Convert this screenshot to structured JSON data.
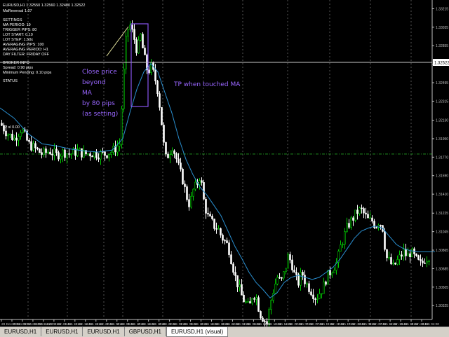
{
  "header": {
    "symbol_line": "EURUSD,H1  1.32550 1.32560 1.32480 1.32522",
    "ea_name": "MaReversal 1.07",
    "settings": [
      "SETTINGS",
      "MA PERIOD: 19",
      "TRIGGER PIPS: 80",
      "LOT START: 0.10",
      "LOT STEP: 1.50x",
      "AVERAGING PIPS: 100",
      "AVERAGING PERIOD: H1",
      "DAY FILTER: FRIDAY OFF"
    ],
    "broker": [
      "BROKER INFO",
      "Spread: 0.90 pips",
      "Minimum Pending: 0.10 pips"
    ],
    "status": "STATUS"
  },
  "annotations": {
    "close_price": [
      "Close price",
      "beyond",
      "MA",
      "by 80 pips",
      "(as setting)"
    ],
    "tp": "TP when touched MA"
  },
  "hline_label": "#2 sl 0.00",
  "tabs": [
    "EURUSD,H1",
    "EURUSD,H1",
    "EURUSD,H1",
    "GBPUSD,H1",
    "EURUSD,H1 (visual)"
  ],
  "active_tab": 4,
  "colors": {
    "background": "#000000",
    "bull": "#00c800",
    "bear": "#ffffff",
    "ma": "#2a8fd0",
    "hline": "#1f8f1f",
    "annotation": "#9966ff",
    "grid": "#8a8a8a",
    "axis_text": "#c0c0c0",
    "price_box": "#ffffff"
  },
  "chart_data": {
    "type": "candlestick",
    "symbol": "EURUSD",
    "timeframe": "H1",
    "ylim": [
      1.3019,
      1.333
    ],
    "y_ticks": [
      1.33215,
      1.33035,
      1.32855,
      1.32675,
      1.32495,
      1.32315,
      1.3213,
      1.3195,
      1.3177,
      1.3159,
      1.3141,
      1.31225,
      1.31045,
      1.30865,
      1.30685,
      1.30505,
      1.30325
    ],
    "current_price": 1.32522,
    "horizontal_line": 1.318,
    "x_tick_labels": [
      "28 Dec 2012",
      "31 Dec 2012",
      "31 Dec 16:00",
      "31 Dec 22:00",
      "1 Jan 02:00",
      "1 Jan 06:00",
      "1 Jan 10:00",
      "1 Jan 14:00",
      "1 Jan 18:00",
      "1 Jan 22:00",
      "2 Jan 02:00",
      "2 Jan 06:00",
      "2 Jan 10:00",
      "2 Jan 14:00",
      "2 Jan 18:00",
      "2 Jan 22:00",
      "3 Jan 02:00",
      "3 Jan 06:00",
      "3 Jan 10:00",
      "3 Jan 14:00",
      "3 Jan 18:00",
      "3 Jan 22:00",
      "4 Jan 02:00",
      "4 Jan 06:00",
      "4 Jan 10:00",
      "4 Jan 14:00",
      "4 Jan 18:00",
      "4 Jan 22:00",
      "7 Jan 03:00",
      "7 Jan 07:00",
      "7 Jan 11:00",
      "7 Jan 15:00",
      "7 Jan 19:00",
      "7 Jan 23:00",
      "8 Jan 03:00",
      "8 Jan 07:00",
      "8 Jan 11:00",
      "8 Jan 15:00",
      "8 Jan 19:00",
      "8 Jan 23:00",
      "9 Jan 04:00"
    ],
    "close_path": [
      [
        0,
        1.321
      ],
      [
        10,
        1.32
      ],
      [
        20,
        1.3195
      ],
      [
        30,
        1.3205
      ],
      [
        40,
        1.319
      ],
      [
        50,
        1.3185
      ],
      [
        60,
        1.318
      ],
      [
        70,
        1.3183
      ],
      [
        80,
        1.3179
      ],
      [
        90,
        1.3182
      ],
      [
        100,
        1.318
      ],
      [
        110,
        1.3183
      ],
      [
        120,
        1.318
      ],
      [
        130,
        1.3181
      ],
      [
        140,
        1.318
      ],
      [
        150,
        1.318
      ],
      [
        160,
        1.3183
      ],
      [
        170,
        1.319
      ],
      [
        176,
        1.326
      ],
      [
        180,
        1.33
      ],
      [
        185,
        1.3305
      ],
      [
        190,
        1.3295
      ],
      [
        195,
        1.328
      ],
      [
        200,
        1.3295
      ],
      [
        205,
        1.3275
      ],
      [
        210,
        1.326
      ],
      [
        215,
        1.3265
      ],
      [
        220,
        1.3255
      ],
      [
        225,
        1.324
      ],
      [
        230,
        1.321
      ],
      [
        235,
        1.3175
      ],
      [
        240,
        1.318
      ],
      [
        245,
        1.3188
      ],
      [
        250,
        1.3178
      ],
      [
        255,
        1.3165
      ],
      [
        260,
        1.3155
      ],
      [
        265,
        1.314
      ],
      [
        270,
        1.313
      ],
      [
        275,
        1.3145
      ],
      [
        280,
        1.315
      ],
      [
        285,
        1.316
      ],
      [
        290,
        1.3135
      ],
      [
        295,
        1.312
      ],
      [
        300,
        1.3115
      ],
      [
        305,
        1.311
      ],
      [
        310,
        1.3108
      ],
      [
        315,
        1.31
      ],
      [
        320,
        1.3095
      ],
      [
        325,
        1.309
      ],
      [
        330,
        1.3075
      ],
      [
        335,
        1.306
      ],
      [
        340,
        1.305
      ],
      [
        345,
        1.304
      ],
      [
        350,
        1.3035
      ],
      [
        355,
        1.303
      ],
      [
        360,
        1.3045
      ],
      [
        365,
        1.304
      ],
      [
        370,
        1.3025
      ],
      [
        375,
        1.302
      ],
      [
        380,
        1.3015
      ],
      [
        385,
        1.3035
      ],
      [
        390,
        1.305
      ],
      [
        395,
        1.306
      ],
      [
        400,
        1.3055
      ],
      [
        405,
        1.3065
      ],
      [
        410,
        1.308
      ],
      [
        415,
        1.3075
      ],
      [
        420,
        1.306
      ],
      [
        425,
        1.3055
      ],
      [
        430,
        1.3065
      ],
      [
        435,
        1.3055
      ],
      [
        440,
        1.305
      ],
      [
        445,
        1.3045
      ],
      [
        450,
        1.304
      ],
      [
        455,
        1.3045
      ],
      [
        460,
        1.305
      ],
      [
        465,
        1.306
      ],
      [
        470,
        1.3065
      ],
      [
        475,
        1.307
      ],
      [
        480,
        1.3075
      ],
      [
        485,
        1.309
      ],
      [
        490,
        1.31
      ],
      [
        495,
        1.311
      ],
      [
        500,
        1.3115
      ],
      [
        505,
        1.312
      ],
      [
        510,
        1.3125
      ],
      [
        515,
        1.3125
      ],
      [
        520,
        1.312
      ],
      [
        525,
        1.3115
      ],
      [
        530,
        1.3115
      ],
      [
        535,
        1.311
      ],
      [
        540,
        1.3115
      ],
      [
        545,
        1.3108
      ],
      [
        550,
        1.308
      ],
      [
        555,
        1.3075
      ],
      [
        560,
        1.307
      ],
      [
        565,
        1.3075
      ],
      [
        570,
        1.308
      ],
      [
        575,
        1.3085
      ],
      [
        580,
        1.308
      ],
      [
        585,
        1.3085
      ],
      [
        590,
        1.308
      ],
      [
        595,
        1.3075
      ],
      [
        600,
        1.3072
      ],
      [
        605,
        1.3078
      ],
      [
        610,
        1.308
      ],
      [
        615,
        1.3085
      ],
      [
        620,
        1.3082
      ]
    ],
    "ma_path": [
      [
        0,
        1.3225
      ],
      [
        20,
        1.3215
      ],
      [
        40,
        1.32
      ],
      [
        60,
        1.319
      ],
      [
        80,
        1.3188
      ],
      [
        100,
        1.3185
      ],
      [
        120,
        1.3183
      ],
      [
        140,
        1.3182
      ],
      [
        160,
        1.3184
      ],
      [
        175,
        1.3195
      ],
      [
        185,
        1.322
      ],
      [
        195,
        1.3243
      ],
      [
        205,
        1.326
      ],
      [
        215,
        1.3268
      ],
      [
        225,
        1.326
      ],
      [
        235,
        1.324
      ],
      [
        245,
        1.322
      ],
      [
        255,
        1.3195
      ],
      [
        265,
        1.3175
      ],
      [
        275,
        1.316
      ],
      [
        285,
        1.3148
      ],
      [
        295,
        1.314
      ],
      [
        305,
        1.313
      ],
      [
        315,
        1.312
      ],
      [
        325,
        1.3105
      ],
      [
        335,
        1.309
      ],
      [
        345,
        1.3078
      ],
      [
        355,
        1.3065
      ],
      [
        365,
        1.3055
      ],
      [
        375,
        1.3048
      ],
      [
        385,
        1.304
      ],
      [
        395,
        1.3045
      ],
      [
        405,
        1.3055
      ],
      [
        415,
        1.306
      ],
      [
        425,
        1.3062
      ],
      [
        435,
        1.306
      ],
      [
        445,
        1.3058
      ],
      [
        455,
        1.306
      ],
      [
        465,
        1.3065
      ],
      [
        475,
        1.307
      ],
      [
        485,
        1.3078
      ],
      [
        495,
        1.3088
      ],
      [
        505,
        1.3098
      ],
      [
        515,
        1.3105
      ],
      [
        525,
        1.3108
      ],
      [
        535,
        1.311
      ],
      [
        545,
        1.3108
      ],
      [
        555,
        1.31
      ],
      [
        565,
        1.3092
      ],
      [
        575,
        1.3088
      ],
      [
        585,
        1.3086
      ],
      [
        595,
        1.3085
      ],
      [
        605,
        1.3085
      ],
      [
        615,
        1.3085
      ],
      [
        620,
        1.3085
      ]
    ]
  }
}
